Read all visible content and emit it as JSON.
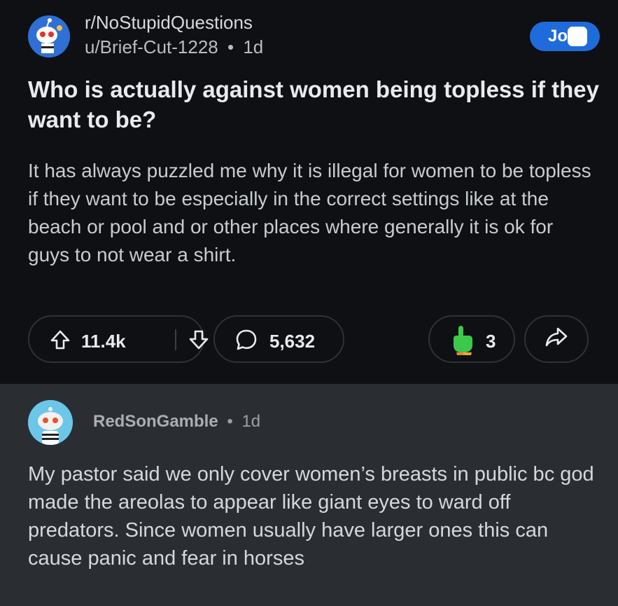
{
  "post": {
    "subreddit": "r/NoStupidQuestions",
    "author": "u/Brief-Cut-1228",
    "separator": "•",
    "age": "1d",
    "join_label": "Jo",
    "title": "Who is actually against women being topless if they want to be?",
    "body": "It has always puzzled me why it is illegal for women to be topless if they want to be especially in the correct settings like at the beach or pool and or other places where generally it is ok for guys to not wear a shirt.",
    "upvotes": "11.4k",
    "comments": "5,632",
    "awards": "3",
    "icons": {
      "subreddit_avatar": "snoo-avatar-icon",
      "upvote": "arrow-up-icon",
      "downvote": "arrow-down-icon",
      "comments": "speech-bubble-icon",
      "award": "pointing-hand-icon",
      "share": "share-arrow-icon"
    },
    "colors": {
      "accent": "#1f6bdc",
      "award": "#3cc84b"
    }
  },
  "comment": {
    "author": "RedSonGamble",
    "separator": "•",
    "age": "1d",
    "text": "My pastor said we only cover women’s breasts in public bc god made the areolas to appear like giant eyes to ward off predators. Since women usually have larger ones this can cause panic and fear in horses",
    "avatar_icon": "snoo-avatar-icon"
  }
}
